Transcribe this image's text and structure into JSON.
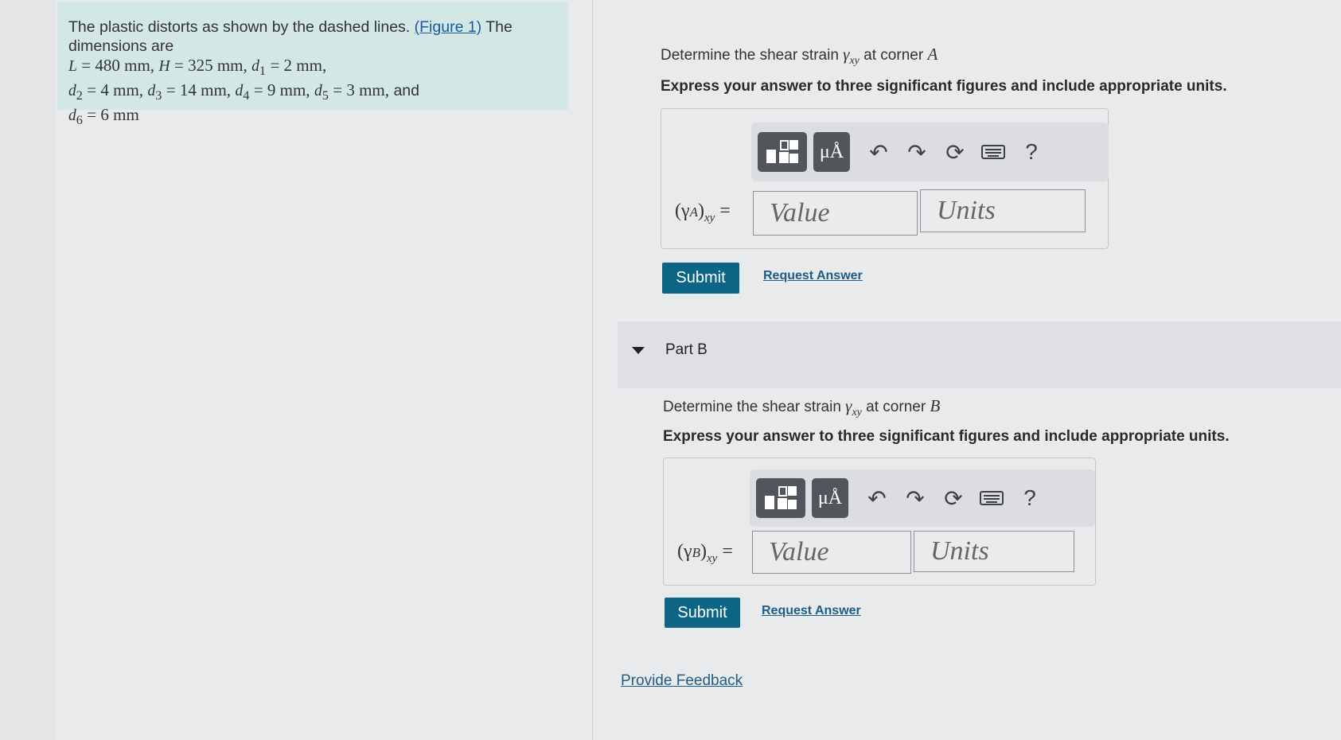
{
  "problem": {
    "text_before_link": "The plastic distorts as shown by the dashed lines.",
    "figure_link": "(Figure 1)",
    "text_after_link": "The dimensions are",
    "dimensions": [
      {
        "sym": "L",
        "val": "= 480 mm,"
      },
      {
        "sym": "H",
        "val": "= 325 mm,"
      },
      {
        "sym": "d",
        "sub": "1",
        "val": "= 2 mm,"
      },
      {
        "sym": "d",
        "sub": "2",
        "val": "= 4 mm,"
      },
      {
        "sym": "d",
        "sub": "3",
        "val": "= 14 mm,"
      },
      {
        "sym": "d",
        "sub": "4",
        "val": "= 9 mm,"
      },
      {
        "sym": "d",
        "sub": "5",
        "val": "= 3 mm,"
      },
      {
        "sym": "d",
        "sub": "6",
        "val": "= 6 mm"
      }
    ],
    "and_word": "and"
  },
  "partA": {
    "question_prefix": "Determine the shear strain",
    "gamma_sym": "γ",
    "gamma_sub": "xy",
    "question_suffix": "at corner",
    "corner": "A",
    "instruction": "Express your answer to three significant figures and include appropriate units.",
    "label_main": "(γ",
    "label_inner": "A",
    "label_close": ")",
    "label_sub": "xy",
    "label_eq": "=",
    "value_placeholder": "Value",
    "units_placeholder": "Units",
    "submit_label": "Submit",
    "request_label": "Request Answer"
  },
  "partB": {
    "title": "Part B",
    "question_prefix": "Determine the shear strain",
    "gamma_sym": "γ",
    "gamma_sub": "xy",
    "question_suffix": "at corner",
    "corner": "B",
    "instruction": "Express your answer to three significant figures and include appropriate units.",
    "label_main": "(γ",
    "label_inner": "B",
    "label_close": ")",
    "label_sub": "xy",
    "label_eq": "=",
    "value_placeholder": "Value",
    "units_placeholder": "Units",
    "submit_label": "Submit",
    "request_label": "Request Answer"
  },
  "toolbar": {
    "units_glyph": "μÅ",
    "help_glyph": "?",
    "icons": [
      "templates-icon",
      "units-icon",
      "undo-icon",
      "redo-icon",
      "reset-icon",
      "keyboard-icon",
      "help-icon"
    ]
  },
  "feedback_label": "Provide Feedback"
}
